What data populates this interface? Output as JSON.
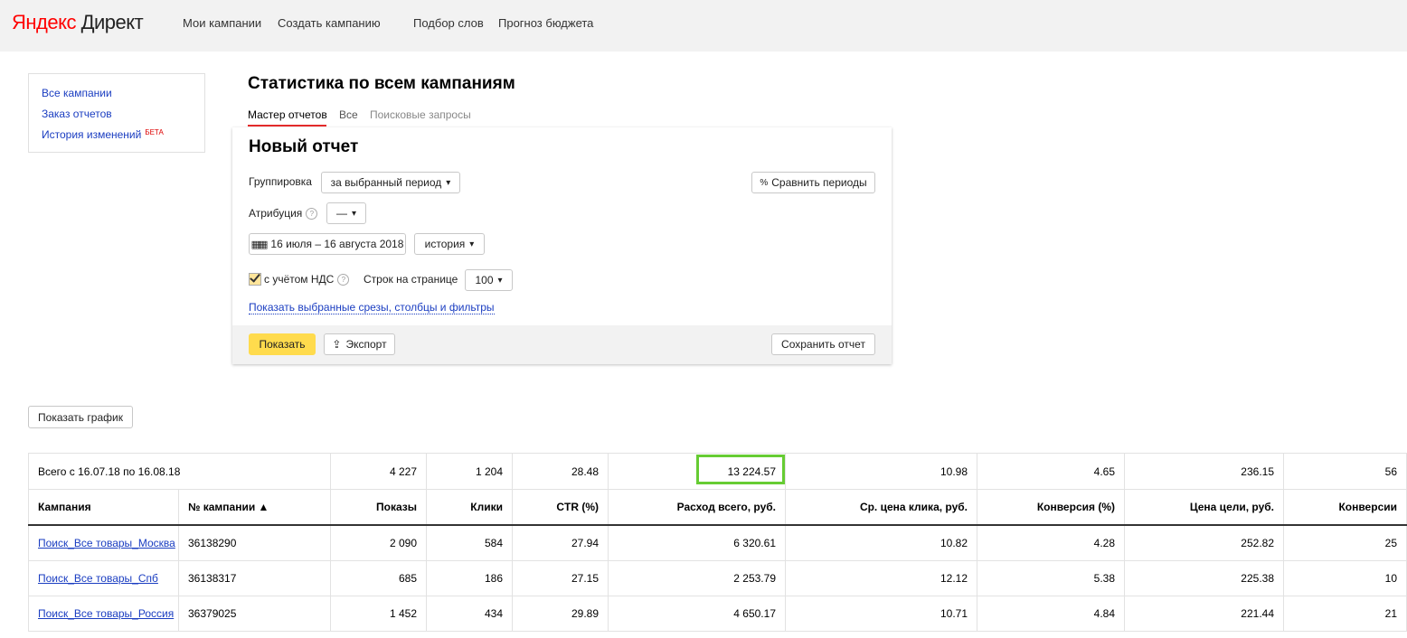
{
  "header": {
    "logo_ya": "Яндекс",
    "logo_direct": "Директ",
    "nav": [
      "Мои кампании",
      "Создать кампанию",
      "Подбор слов",
      "Прогноз бюджета"
    ]
  },
  "sidebar": {
    "items": [
      {
        "label": "Все кампании"
      },
      {
        "label": "Заказ отчетов"
      },
      {
        "label": "История изменений",
        "badge": "БЕТА"
      }
    ]
  },
  "page": {
    "title": "Статистика по всем кампаниям",
    "tabs": [
      "Мастер отчетов",
      "Все",
      "Поисковые запросы"
    ]
  },
  "report": {
    "title": "Новый отчет",
    "grouping_label": "Группировка",
    "grouping_value": "за выбранный период",
    "compare_button": "Сравнить периоды",
    "attribution_label": "Атрибуция",
    "attribution_value": "—",
    "date_range": "16 июля – 16 августа 2018",
    "history_value": "история",
    "vat_label": "с учётом НДС",
    "vat_checked": true,
    "rows_label": "Строк на странице",
    "rows_value": "100",
    "filters_link": "Показать выбранные срезы, столбцы и фильтры",
    "show_button": "Показать",
    "export_button": "Экспорт",
    "save_button": "Сохранить отчет"
  },
  "chart_button": "Показать график",
  "table": {
    "total": {
      "label": "Всего с 16.07.18 по 16.08.18",
      "impressions": "4 227",
      "clicks": "1 204",
      "ctr": "28.48",
      "spend": "13 224.57",
      "cpc": "10.98",
      "conv_rate": "4.65",
      "cpa": "236.15",
      "conversions": "56"
    },
    "headers": [
      "Кампания",
      "№ кампании ▲",
      "Показы",
      "Клики",
      "CTR (%)",
      "Расход всего, руб.",
      "Ср. цена клика, руб.",
      "Конверсия (%)",
      "Цена цели, руб.",
      "Конверсии"
    ],
    "rows": [
      {
        "name": "Поиск_Все товары_Москва",
        "id": "36138290",
        "impressions": "2 090",
        "clicks": "584",
        "ctr": "27.94",
        "spend": "6 320.61",
        "cpc": "10.82",
        "conv_rate": "4.28",
        "cpa": "252.82",
        "conversions": "25"
      },
      {
        "name": "Поиск_Все товары_Спб",
        "id": "36138317",
        "impressions": "685",
        "clicks": "186",
        "ctr": "27.15",
        "spend": "2 253.79",
        "cpc": "12.12",
        "conv_rate": "5.38",
        "cpa": "225.38",
        "conversions": "10"
      },
      {
        "name": "Поиск_Все товары_Россия",
        "id": "36379025",
        "impressions": "1 452",
        "clicks": "434",
        "ctr": "29.89",
        "spend": "4 650.17",
        "cpc": "10.71",
        "conv_rate": "4.84",
        "cpa": "221.44",
        "conversions": "21"
      }
    ]
  }
}
